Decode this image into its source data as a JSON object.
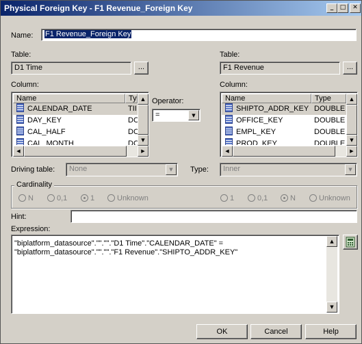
{
  "window": {
    "title": "Physical Foreign Key - F1 Revenue_Foreign Key"
  },
  "name": {
    "label": "Name:",
    "value": "F1 Revenue_Foreign Key"
  },
  "left": {
    "table_label": "Table:",
    "table_value": "D1 Time",
    "browse_label": "...",
    "column_label": "Column:",
    "headers": [
      "Name",
      "Ty"
    ],
    "rows": [
      {
        "name": "CALENDAR_DATE",
        "type": "TII"
      },
      {
        "name": "DAY_KEY",
        "type": "DC"
      },
      {
        "name": "CAL_HALF",
        "type": "DC"
      },
      {
        "name": "CAL_MONTH",
        "type": "DC"
      }
    ]
  },
  "right": {
    "table_label": "Table:",
    "table_value": "F1 Revenue",
    "browse_label": "...",
    "column_label": "Column:",
    "headers": [
      "Name",
      "Type"
    ],
    "rows": [
      {
        "name": "SHIPTO_ADDR_KEY",
        "type": "DOUBLE"
      },
      {
        "name": "OFFICE_KEY",
        "type": "DOUBLE"
      },
      {
        "name": "EMPL_KEY",
        "type": "DOUBLE"
      },
      {
        "name": "PROD_KEY",
        "type": "DOUBLE"
      }
    ]
  },
  "operator": {
    "label": "Operator:",
    "value": "="
  },
  "driving": {
    "label": "Driving table:",
    "value": "None"
  },
  "type": {
    "label": "Type:",
    "value": "Inner"
  },
  "cardinality": {
    "label": "Cardinality",
    "left_options": [
      "N",
      "0,1",
      "1",
      "Unknown"
    ],
    "right_options": [
      "1",
      "0,1",
      "N",
      "Unknown"
    ]
  },
  "hint": {
    "label": "Hint:",
    "value": ""
  },
  "expression": {
    "label": "Expression:",
    "line1": "\"biplatform_datasource\".\"\".\"\".\"D1 Time\".\"CALENDAR_DATE\" =",
    "line2": "\"biplatform_datasource\".\"\".\"\".\"F1 Revenue\".\"SHIPTO_ADDR_KEY\""
  },
  "buttons": {
    "ok": "OK",
    "cancel": "Cancel",
    "help": "Help"
  }
}
